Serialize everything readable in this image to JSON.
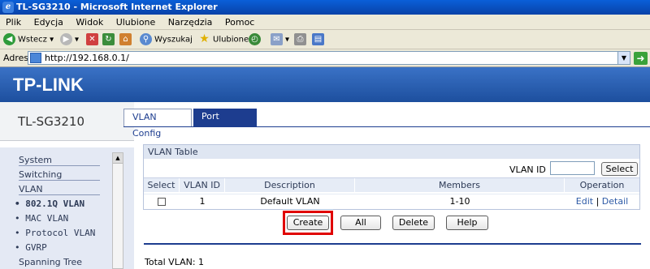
{
  "window": {
    "title": "TL-SG3210 - Microsoft Internet Explorer"
  },
  "menu": [
    "Plik",
    "Edycja",
    "Widok",
    "Ulubione",
    "Narzędzia",
    "Pomoc"
  ],
  "toolbar": {
    "back": "Wstecz",
    "search": "Wyszukaj",
    "favorites": "Ulubione"
  },
  "address": {
    "label": "Adres",
    "url": "http://192.168.0.1/"
  },
  "brand": {
    "logo": "TP-LINK",
    "model": "TL-SG3210"
  },
  "nav": {
    "items": [
      "System",
      "Switching",
      "VLAN",
      "• 802.1Q VLAN",
      "• MAC VLAN",
      "• Protocol VLAN",
      "• GVRP",
      "Spanning Tree"
    ]
  },
  "tabs": [
    "VLAN Config",
    "Port Config"
  ],
  "vlan_table": {
    "title": "VLAN Table",
    "vlan_id_label": "VLAN ID",
    "vlan_id_value": "",
    "select_button": "Select",
    "columns": [
      "Select",
      "VLAN ID",
      "Description",
      "Members",
      "Operation"
    ],
    "rows": [
      {
        "vlan_id": "1",
        "description": "Default VLAN",
        "members": "1-10",
        "edit": "Edit",
        "sep": " | ",
        "detail": "Detail"
      }
    ]
  },
  "buttons": {
    "create": "Create",
    "all": "All",
    "delete": "Delete",
    "help": "Help"
  },
  "footer": {
    "total": "Total VLAN: 1"
  }
}
